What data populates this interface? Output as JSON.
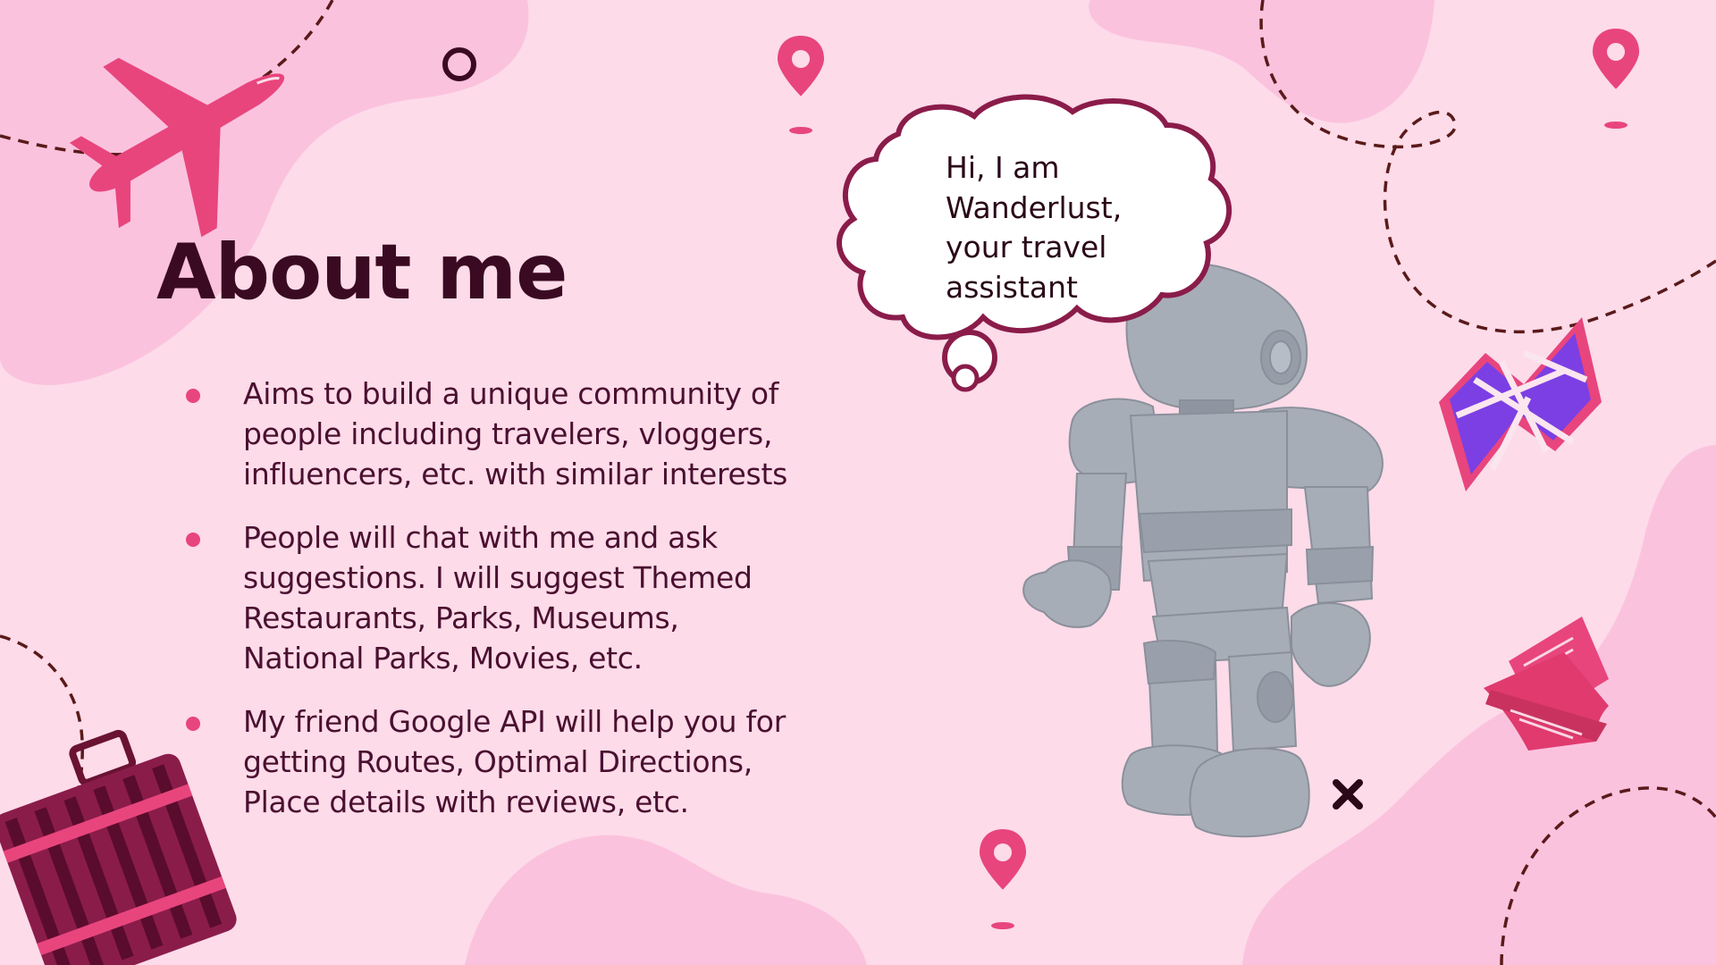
{
  "slide": {
    "title": "About me",
    "bullets": [
      {
        "text": "Aims to build a unique community of\npeople including travelers, vloggers,\ninfluencers, etc. with similar interests"
      },
      {
        "text": "People will chat with me and ask\nsuggestions. I will suggest Themed\nRestaurants, Parks, Museums,\nNational Parks, Movies, etc."
      },
      {
        "text": "My friend Google API will help you for\ngetting Routes, Optimal Directions,\nPlace details with reviews, etc."
      }
    ],
    "speech_bubble": "Hi, I am\nWanderlust,\nyour travel\nassistant"
  },
  "colors": {
    "background": "#fddbe9",
    "blob": "#fbc2de",
    "accent_pink": "#e8457d",
    "title_color": "#3a0a22",
    "body_text": "#4a1030",
    "dashed_line": "#5a1a1a",
    "bubble_outline": "#8a1c4a",
    "robot_gray": "#a7adb7"
  },
  "icons": [
    "airplane-icon",
    "map-pin-icon",
    "folded-map-icon",
    "tickets-icon",
    "suitcase-icon",
    "robot-illustration",
    "thought-bubble",
    "ring-icon",
    "x-mark-icon"
  ]
}
